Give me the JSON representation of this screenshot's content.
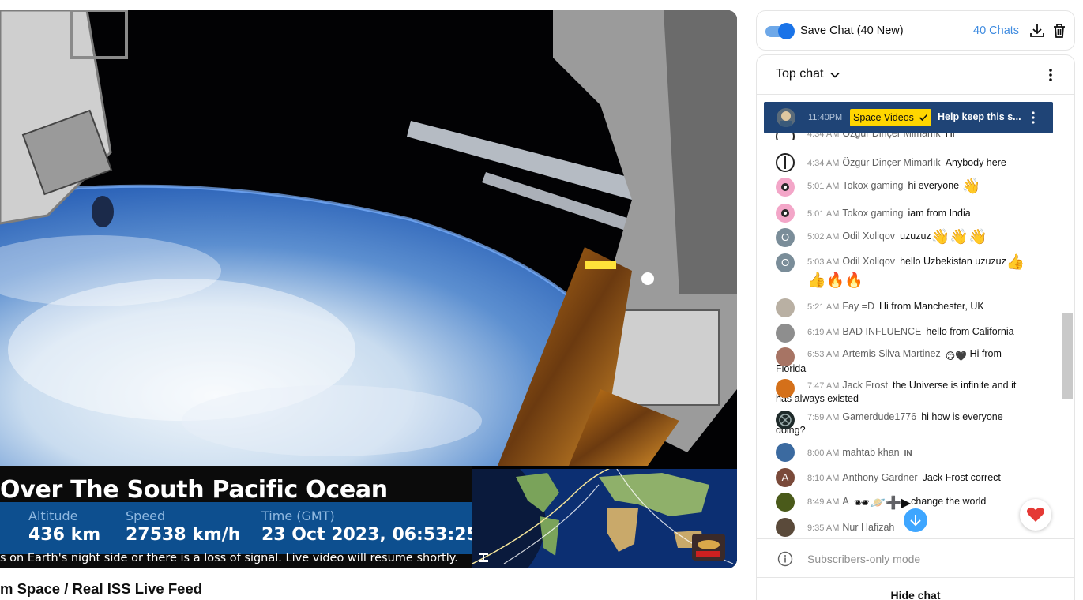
{
  "video": {
    "location_title": "Over The South Pacific Ocean",
    "stats": [
      {
        "label": "Altitude",
        "value": "436 km"
      },
      {
        "label": "Speed",
        "value": "27538 km/h"
      },
      {
        "label": "Time (GMT)",
        "value": "23 Oct 2023, 06:53:25"
      }
    ],
    "notice": "s on Earth's night side or there is a loss of signal. Live video will resume shortly.",
    "title": "m Space / Real ISS Live Feed"
  },
  "savebar": {
    "label": "Save Chat (40 New)",
    "chats_count": "40 Chats",
    "toggle_on": true,
    "accent_color": "#1a73e8"
  },
  "chat": {
    "header_title": "Top chat",
    "pinned": {
      "time": "11:40PM",
      "author": "Space Videos",
      "message": "Help keep this s...",
      "badge_color": "#ffd600"
    },
    "messages": [
      {
        "time": "4:34 AM",
        "author": "Özgür Dinçer Mimarlık",
        "text": "Hi"
      },
      {
        "time": "4:34 AM",
        "author": "Özgür Dinçer Mimarlık",
        "text": "Anybody here"
      },
      {
        "time": "5:01 AM",
        "author": "Tokox gaming",
        "text": "hi everyone",
        "emoji": "👋"
      },
      {
        "time": "5:01 AM",
        "author": "Tokox gaming",
        "text": "iam from India"
      },
      {
        "time": "5:02 AM",
        "author": "Odil Xoliqov",
        "text": "uzuzuz",
        "emoji": "👋👋👋"
      },
      {
        "time": "5:03 AM",
        "author": "Odil Xoliqov",
        "text": "hello Uzbekistan uzuzuz",
        "emoji": "👍",
        "emoji2": "👍🔥🔥"
      },
      {
        "time": "5:21 AM",
        "author": "Fay =D",
        "text": "Hi from Manchester, UK"
      },
      {
        "time": "6:19 AM",
        "author": "BAD INFLUENCE",
        "text": "hello from California"
      },
      {
        "time": "6:53 AM",
        "author": "Artemis Silva Martinez",
        "author_emoji": "😊🖤",
        "text": "Hi from",
        "text2": "Florida"
      },
      {
        "time": "7:47 AM",
        "author": "Jack Frost",
        "text": "the Universe is infinite and it",
        "text2": "has always existed"
      },
      {
        "time": "7:59 AM",
        "author": "Gamerdude1776",
        "text": "hi how is everyone",
        "text2": "doing?"
      },
      {
        "time": "8:00 AM",
        "author": "mahtab khan",
        "text": "IN"
      },
      {
        "time": "8:10 AM",
        "author": "Anthony Gardner",
        "text": "Jack Frost correct"
      },
      {
        "time": "8:49 AM",
        "author": "A",
        "emoji": "🕶🪐➕▶",
        "text": "change the world"
      },
      {
        "time": "9:35 AM",
        "author": "Nur Hafizah",
        "text": ""
      }
    ],
    "subscribers_mode": "Subscribers-only mode",
    "hide_chat": "Hide chat",
    "avatar_letters": {
      "odil": "O",
      "anthony": "A"
    }
  }
}
